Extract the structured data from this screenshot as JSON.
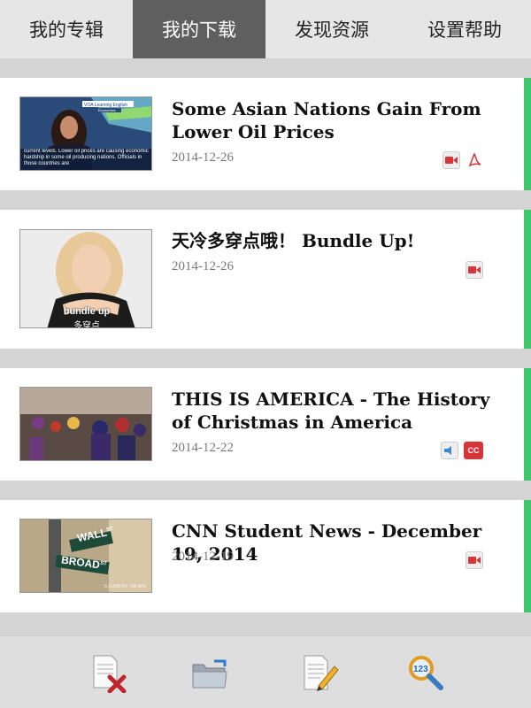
{
  "tabs": [
    {
      "label": "我的专辑"
    },
    {
      "label": "我的下载"
    },
    {
      "label": "发现资源"
    },
    {
      "label": "设置帮助"
    }
  ],
  "items": [
    {
      "title": "Some Asian Nations Gain From Lower Oil Prices",
      "date": "2014-12-26",
      "icons": [
        "video-icon",
        "pdf-icon"
      ],
      "thumb": {
        "banner": "VOA Learning English",
        "sub": "Economics",
        "caption": "current levels. Lower oil prices are causing economic hardship in some oil producing nations. Officials in those countries are"
      }
    },
    {
      "title": "天冷多穿点哦！ Bundle Up!",
      "date": "2014-12-26",
      "icons": [
        "video-icon"
      ],
      "thumb": {
        "caption_en": "bundle up",
        "caption_zh": "多穿点"
      }
    },
    {
      "title": "THIS IS AMERICA - The History of Christmas in America",
      "date": "2014-12-22",
      "icons": [
        "audio-icon",
        "cc-icon"
      ],
      "thumb": {}
    },
    {
      "title": "CNN Student News - December 19, 2014",
      "date": "2014-12-19",
      "icons": [
        "video-icon"
      ],
      "thumb": {
        "sign1": "WALL",
        "sign1_st": "ST",
        "sign2": "BROAD",
        "sign2_st": "ST",
        "watermark": "STUDENT NEWS"
      }
    }
  ],
  "toolbar": [
    "delete-doc-icon",
    "folder-icon",
    "edit-doc-icon",
    "search-icon"
  ],
  "colors": {
    "accent": "#3cc86a",
    "activeTab": "#5f5f5f",
    "cc": "#d9343a",
    "video": "#d9343a"
  }
}
